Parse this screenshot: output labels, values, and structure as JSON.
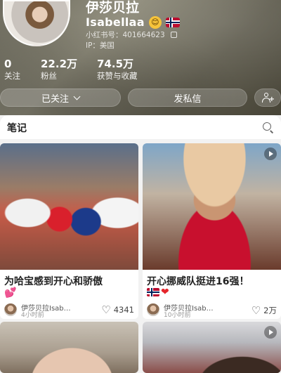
{
  "profile": {
    "display_name": "伊莎贝拉",
    "handle": "Isabellaa",
    "badge_emoji": "😊",
    "redbook_id": "小红书号：401664623",
    "ip_location": "IP：美国"
  },
  "stats": {
    "following_count": "0",
    "following_label": "关注",
    "fans_count": "22.2万",
    "fans_label": "粉丝",
    "likes_count": "74.5万",
    "likes_label": "获赞与收藏"
  },
  "actions": {
    "following_label": "已关注",
    "message_label": "发私信"
  },
  "tabs": {
    "notes_label": "笔记"
  },
  "feed": {
    "cards": [
      {
        "title": "为哈宝感到开心和骄傲",
        "author": "伊莎贝拉Isab…",
        "time": "4小时前",
        "likes": "4341"
      },
      {
        "title": "开心挪威队挺进16强！",
        "author": "伊莎贝拉Isab…",
        "time": "10小时前",
        "likes": "2万"
      }
    ]
  },
  "colors": {
    "accent_red": "#e5252b",
    "pink_heart": "#ff4fa3"
  }
}
